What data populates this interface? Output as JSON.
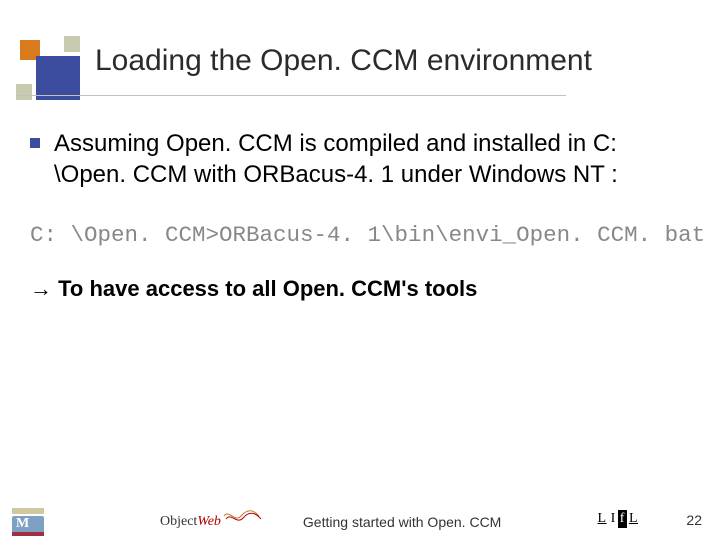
{
  "slide": {
    "title": "Loading the Open. CCM environment",
    "bullet1": "Assuming Open. CCM is compiled and installed in C: \\Open. CCM with ORBacus-4. 1 under Windows NT :",
    "code_line": "C: \\Open. CCM>ORBacus-4. 1\\bin\\envi_Open. CCM. bat",
    "arrow_text": "To have access to all Open. CCM's tools",
    "arrow_glyph": "→"
  },
  "footer": {
    "logo_center_obj": "Object",
    "logo_center_web": "Web",
    "title": "Getting started with Open. CCM",
    "lifl": {
      "l1": "L",
      "i": "I",
      "f": "f",
      "l2": "L"
    },
    "page_number": "22"
  }
}
